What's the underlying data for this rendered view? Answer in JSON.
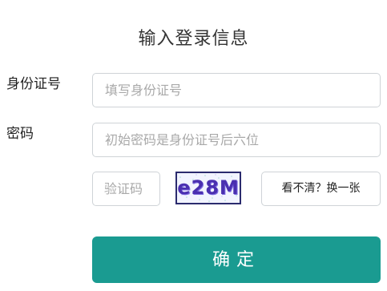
{
  "form": {
    "title": "输入登录信息",
    "id_label": "身份证号",
    "id_placeholder": "填写身份证号",
    "password_label": "密码",
    "password_placeholder": "初始密码是身份证号后六位",
    "captcha_placeholder": "验证码",
    "captcha_text": "e28M",
    "refresh_label": "看不清？换一张",
    "submit_label": "确定"
  },
  "colors": {
    "primary": "#1a9b91",
    "border": "#cfd3d7",
    "placeholder": "#a9a9a9",
    "captcha_text": "#4a2fb0",
    "captcha_border": "#2b2b6e"
  }
}
